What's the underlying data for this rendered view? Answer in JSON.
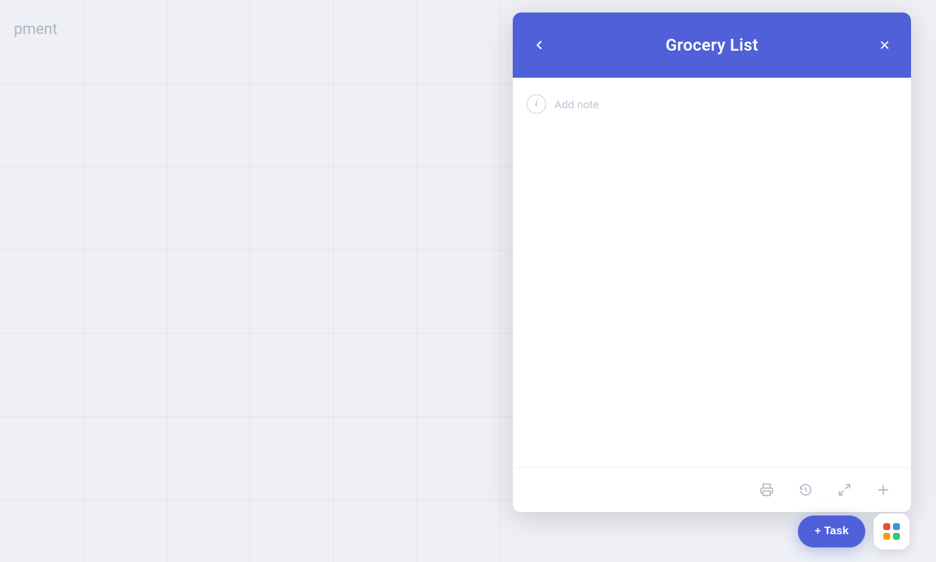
{
  "background": {
    "partial_text": "pment",
    "bg_color": "#eef0f5"
  },
  "panel": {
    "header": {
      "title": "Grocery List",
      "back_label": "‹",
      "close_label": "✕",
      "bg_color": "#5060d8"
    },
    "body": {
      "add_note_placeholder": "Add note"
    },
    "footer": {
      "print_icon": "print",
      "history_icon": "history",
      "expand_icon": "expand",
      "add_icon": "plus"
    }
  },
  "floating": {
    "add_task_label": "+ Task",
    "apps_btn_label": "apps"
  },
  "app_dots": [
    {
      "color": "#e74c3c"
    },
    {
      "color": "#3498db"
    },
    {
      "color": "#f39c12"
    },
    {
      "color": "#2ecc71"
    }
  ]
}
